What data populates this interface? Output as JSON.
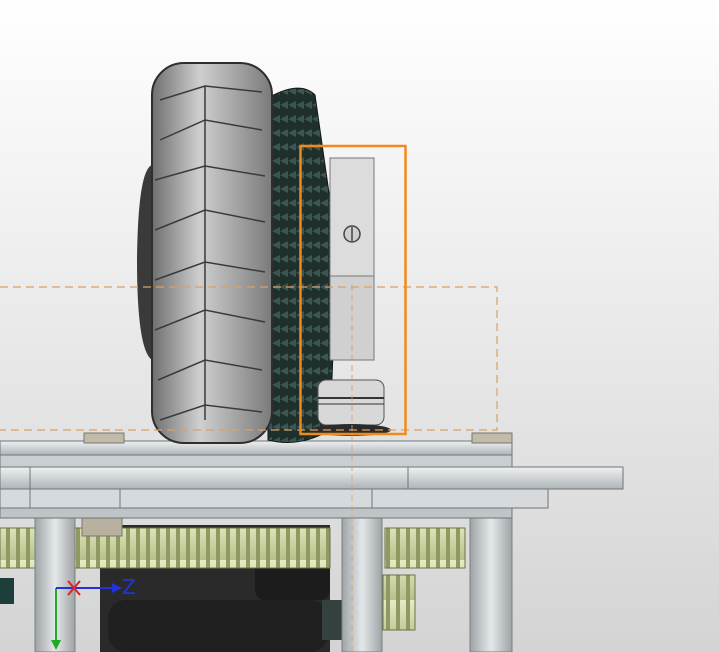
{
  "viewport": {
    "background_top": "#ffffff",
    "background_bottom": "#d4d4d4",
    "highlight_color": "#f28a1a",
    "reference_line_color": "#d9a066"
  },
  "triad": {
    "z_label": "Z",
    "z_color": "#2233dd",
    "x_color": "#dd2222",
    "y_color": "#22aa22"
  },
  "icons": [
    "coordinate-triad-icon",
    "screw-slot-icon"
  ]
}
